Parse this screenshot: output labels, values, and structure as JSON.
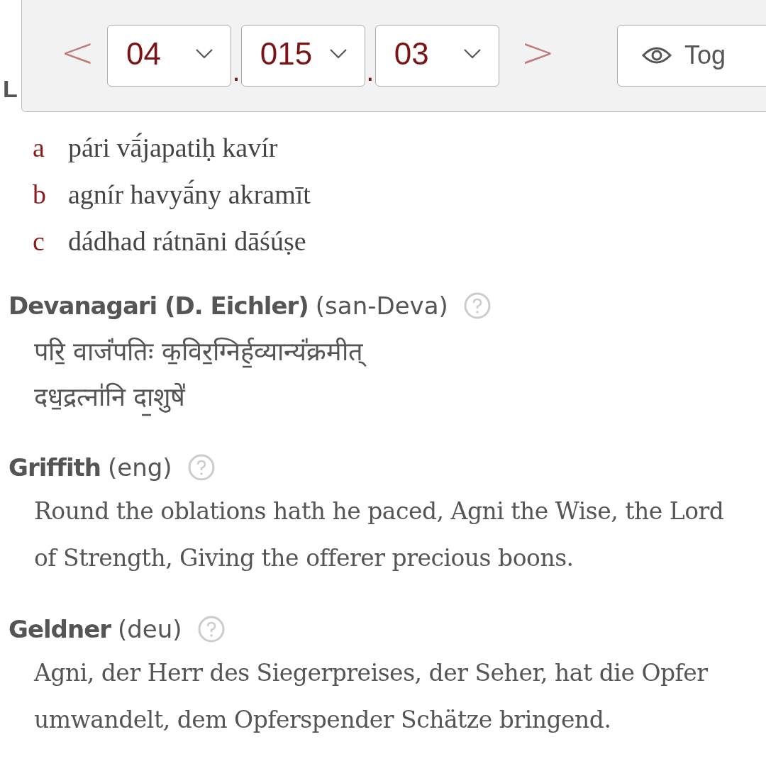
{
  "heading_fragment": "L",
  "toolbar": {
    "prev": "<",
    "next": ">",
    "separator": ".",
    "selects": [
      {
        "value": "04"
      },
      {
        "value": "015"
      },
      {
        "value": "03"
      }
    ],
    "toggle_button": "Tog"
  },
  "verse_lines": [
    {
      "label": "a",
      "text": "pári vā́japatiḥ kavír"
    },
    {
      "label": "b",
      "text": "agnír havyā́ny akramīt"
    },
    {
      "label": "c",
      "text": "dádhad rátnāni dāśúṣe"
    }
  ],
  "sections": [
    {
      "title": "Devanagari (D. Eichler)",
      "lang": "(san-Deva)",
      "kind": "lines",
      "lines": [
        "परि॒ वाजं॑पतिः क॒विर॒ग्निर्ह॒व्यान्यं॑क्रमीत्",
        "दध॒द्रत्ना॑नि दा॒शुषे॑"
      ]
    },
    {
      "title": "Griffith",
      "lang": "(eng)",
      "kind": "paragraph",
      "text": "Round the oblations hath he paced, Agni the Wise, the Lord of Strength, Giving the offerer precious boons."
    },
    {
      "title": "Geldner",
      "lang": "(deu)",
      "kind": "paragraph",
      "text": "Agni, der Herr des Siegerpreises, der Seher, hat die Opfer umwandelt, dem Opferspender Schätze bringend."
    }
  ]
}
